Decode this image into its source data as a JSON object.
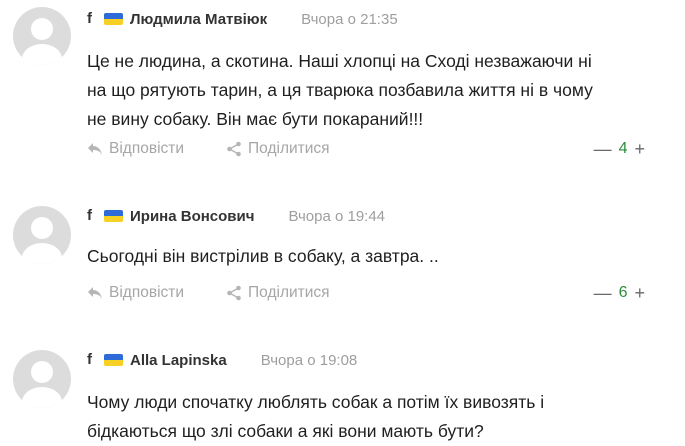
{
  "colors": {
    "flag_blue": "#2e6bd6",
    "flag_yellow": "#f7d023",
    "score_green": "#2e8b3d",
    "muted_text": "#a6a6a6"
  },
  "icons": {
    "network": "facebook-icon",
    "flag": "ukraine-flag-icon",
    "reply": "reply-icon",
    "share": "share-icon"
  },
  "labels": {
    "network_glyph": "f",
    "reply": "Відповісти",
    "share": "Поділитися",
    "vote_down": "—",
    "vote_up": "+"
  },
  "comments": [
    {
      "author": "Людмила Матвіюк",
      "time": "Вчора о 21:35",
      "lines": [
        "Це не людина, а скотина. Наші хлопці на Сході незважаючи ні",
        "на що рятують тарин, а ця тварюка позбавила життя ні в чому",
        "не вину собаку. Він має бути покараний!!!"
      ],
      "score": "4"
    },
    {
      "author": "Ирина Вонсович",
      "time": "Вчора о 19:44",
      "lines": [
        "Сьогодні він вистрілив в собаку, а завтра. .."
      ],
      "score": "6"
    },
    {
      "author": "Alla Lapinska",
      "time": "Вчора о 19:08",
      "lines": [
        "Чому люди спочатку люблять собак а потім їх вивозять і",
        "бідкаються  що злі собаки а які вони мають бути?"
      ],
      "score": null
    }
  ]
}
